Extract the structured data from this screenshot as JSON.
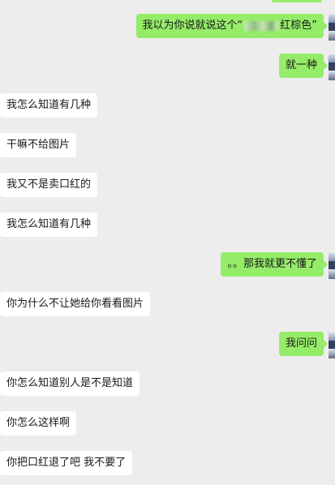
{
  "messages": [
    {
      "dir": "out",
      "text_before": "我以为你说就说这个“",
      "text_after": "红棕色”",
      "redacted": true
    },
    {
      "dir": "out",
      "text": "就一种"
    },
    {
      "dir": "in",
      "text": "我怎么知道有几种"
    },
    {
      "dir": "in",
      "text": "干嘛不给图片"
    },
    {
      "dir": "in",
      "text": "我又不是卖口红的"
    },
    {
      "dir": "in",
      "text": "我怎么知道有几种"
    },
    {
      "dir": "out",
      "text": "。。那我就更不懂了"
    },
    {
      "dir": "in",
      "text": "你为什么不让她给你看看图片"
    },
    {
      "dir": "out",
      "text": "我问问"
    },
    {
      "dir": "in",
      "text": "你怎么知道别人是不是知道"
    },
    {
      "dir": "in",
      "text": "你怎么这样啊"
    },
    {
      "dir": "in",
      "text": "你把口红退了吧 我不要了"
    }
  ],
  "colors": {
    "background": "#ededed",
    "outgoing": "#95ec69",
    "incoming": "#ffffff"
  }
}
